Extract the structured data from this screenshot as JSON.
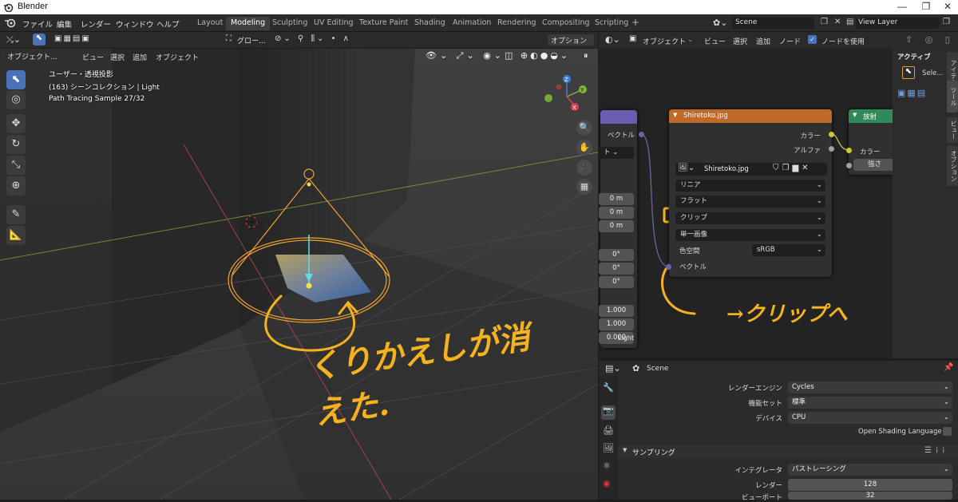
{
  "titlebar": {
    "app": "Blender"
  },
  "topbar": {
    "menus": [
      "ファイル",
      "編集",
      "レンダー",
      "ウィンドウ",
      "ヘルプ"
    ],
    "tabs": [
      "Layout",
      "Modeling",
      "Sculpting",
      "UV Editing",
      "Texture Paint",
      "Shading",
      "Animation",
      "Rendering",
      "Compositing",
      "Scripting"
    ],
    "add_tab": "+",
    "scene": "Scene",
    "view_layer": "View Layer"
  },
  "viewport": {
    "mode": "オブジェクト...",
    "menus": [
      "ビュー",
      "選択",
      "追加",
      "オブジェクト"
    ],
    "transform": "グロー...",
    "options": "オプション",
    "info_lines": [
      "ユーザー・透視投影",
      "(163) シーンコレクション | Light",
      "Path Tracing Sample 27/32"
    ],
    "gizmo_axes": {
      "x": "X",
      "y": "Y",
      "z": "Z"
    }
  },
  "node_editor": {
    "type": "オブジェクト",
    "menus": [
      "ビュー",
      "選択",
      "追加",
      "ノード"
    ],
    "use_nodes": "ノードを使用",
    "image_node": {
      "title": "Shiretoko.jpg",
      "out_color": "カラー",
      "out_alpha": "アルファ",
      "image_name": "Shiretoko.jpg",
      "interpolation": "リニア",
      "projection": "フラット",
      "extension": "クリップ",
      "source": "単一画像",
      "colorspace_label": "色空間",
      "colorspace": "sRGB",
      "in_vector": "ベクトル"
    },
    "left_node": {
      "vector": "ベクトル",
      "dropdown": "ト",
      "values_m": [
        "0 m",
        "0 m",
        "0 m"
      ],
      "values_deg": [
        "0°",
        "0°",
        "0°"
      ],
      "values_scale": [
        "1.000",
        "1.000",
        "0.000"
      ],
      "light": "Light"
    },
    "emission_node": {
      "title": "放射",
      "color": "カラー",
      "strength": "強さ"
    }
  },
  "node_sidebar": {
    "header": "アクティブ",
    "item": "Sele...",
    "tabs": [
      "アイテム",
      "ツール",
      "ビュー",
      "オプション"
    ]
  },
  "properties": {
    "scene": "Scene",
    "render_engine_label": "レンダーエンジン",
    "render_engine": "Cycles",
    "feature_set_label": "機能セット",
    "feature_set": "標準",
    "device_label": "デバイス",
    "device": "CPU",
    "osl": "Open Shading Language",
    "sampling": "サンプリング",
    "integrator_label": "インテグレータ",
    "integrator": "パストレーシング",
    "render_label": "レンダー",
    "render_samples": "128",
    "viewport_label": "ビューポート",
    "viewport_samples": "32"
  },
  "annotations": {
    "left": "くりかえしが消えた.",
    "right": "→クリップへ"
  },
  "colors": {
    "annotation": "#f5b21f",
    "image_node_header": "#c06a2a",
    "emission_header": "#2f8a5a",
    "left_node_header": "#6b5cb0",
    "active_tool": "#4a72b8"
  }
}
